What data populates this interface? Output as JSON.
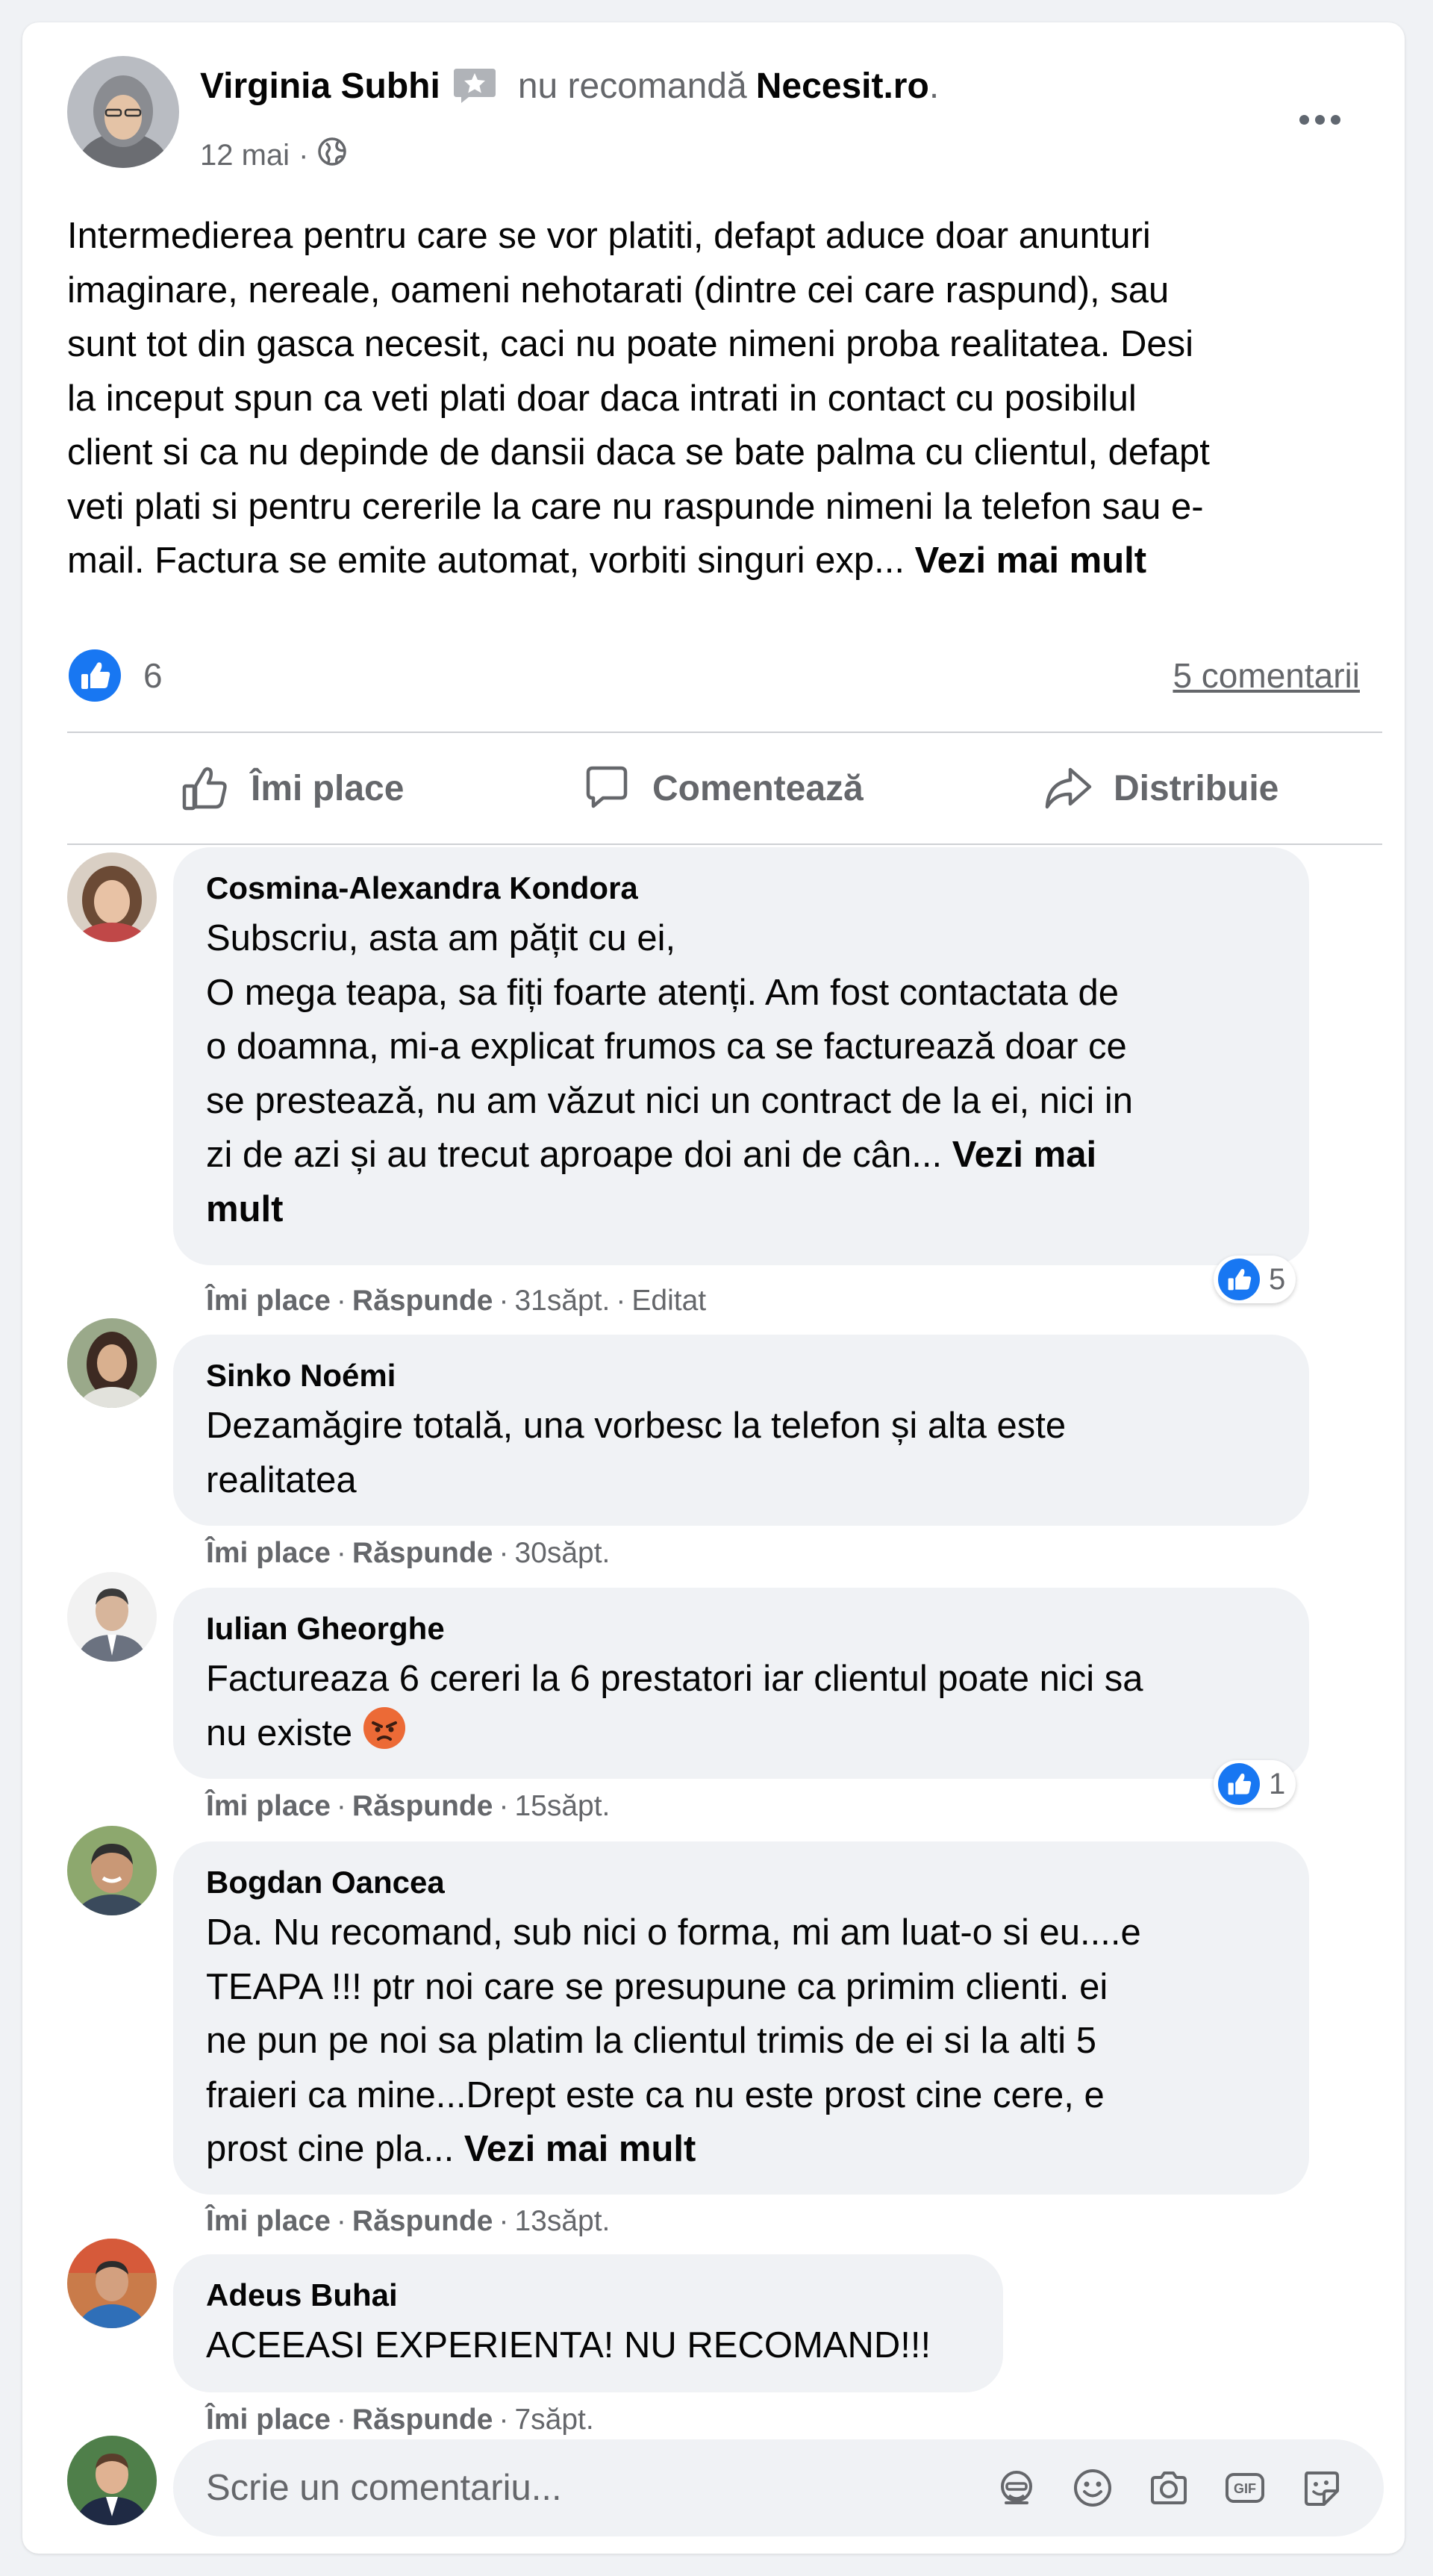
{
  "post": {
    "author": "Virginia Subhi",
    "action": "nu recomandă",
    "page": "Necesit.ro",
    "date": "12 mai",
    "separator": "·",
    "lines": [
      "Intermedierea pentru care se vor platiti, defapt aduce doar anunturi",
      "imaginare, nereale, oameni nehotarati (dintre cei care raspund), sau",
      "sunt tot din gasca necesit, caci nu poate nimeni proba realitatea. Desi",
      "la inceput spun ca veti plati doar daca intrati in contact cu posibilul",
      "client si ca nu depinde de dansii daca se bate palma cu clientul, defapt",
      "veti plati si pentru cererile la care nu raspunde nimeni la telefon sau e-",
      "mail. Factura se emite automat, vorbiti singuri exp..."
    ],
    "see_more": "Vezi mai mult",
    "like_count": "6",
    "comments_link": "5 comentarii"
  },
  "actions": {
    "like": "Îmi place",
    "comment": "Comentează",
    "share": "Distribuie"
  },
  "comment_actions": {
    "like": "Îmi place",
    "reply": "Răspunde"
  },
  "comments": [
    {
      "author": "Cosmina-Alexandra Kondora",
      "lines": [
        "Subscriu, asta am pățit cu ei,",
        "O mega teapa, sa fiți foarte atenți. Am fost contactata de",
        "o doamna, mi-a explicat frumos ca se facturează doar ce",
        "se prestează, nu am văzut nici un contract de la ei, nici in",
        "zi de azi și au trecut aproape doi ani de cân..."
      ],
      "see_more_a": "Vezi mai",
      "see_more_b": "mult",
      "time": "31săpt.",
      "edited": "Editat",
      "reactions": "5"
    },
    {
      "author": "Sinko Noémi",
      "lines": [
        "Dezamăgire totală, una vorbesc la telefon și alta este",
        "realitatea"
      ],
      "time": "30săpt."
    },
    {
      "author": "Iulian Gheorghe",
      "lines": [
        "Factureaza 6 cereri la 6 prestatori iar clientul poate nici sa",
        "nu existe"
      ],
      "emoji": "angry-face-icon",
      "time": "15săpt.",
      "reactions": "1"
    },
    {
      "author": "Bogdan Oancea",
      "lines": [
        "Da. Nu recomand, sub nici o forma, mi am luat-o si eu....e",
        "TEAPA !!! ptr noi care se presupune ca primim clienti. ei",
        "ne pun pe noi sa platim la clientul trimis de ei si la alti 5",
        "fraieri ca mine...Drept este ca nu este prost cine cere, e",
        "prost cine pla..."
      ],
      "see_more": "Vezi mai mult",
      "time": "13săpt."
    },
    {
      "author": "Adeus Buhai",
      "lines": [
        "ACEEASI EXPERIENTA! NU RECOMAND!!!"
      ],
      "time": "7săpt."
    }
  ],
  "composer": {
    "placeholder": "Scrie un comentariu...",
    "icons": [
      "avatar-sticker-icon",
      "emoji-icon",
      "camera-icon",
      "gif-icon",
      "sticker-icon"
    ]
  },
  "colors": {
    "background": "#f0f2f5",
    "card": "#ffffff",
    "primary_text": "#050505",
    "secondary_text": "#65676b",
    "like_blue": "#1877f2",
    "divider": "#ced0d4"
  }
}
